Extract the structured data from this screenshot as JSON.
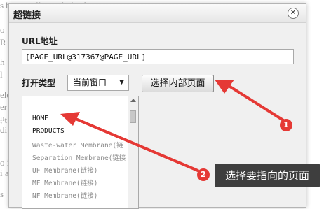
{
  "background": {
    "lines": [
      "s been well popularized",
      "o",
      "R",
      "h",
      "l",
      "ele",
      "er",
      "n",
      ", t",
      "di",
      "o is",
      "i ar",
      "s"
    ]
  },
  "dialog": {
    "title": "超链接",
    "url_label": "URL地址",
    "url_value": "[PAGE_URL@317367@PAGE_URL]",
    "open_type_label": "打开类型",
    "open_type_selected": "当前窗口",
    "internal_page_button": "选择内部页面",
    "page_list": [
      "HOME",
      "PRODUCTS",
      "Waste-water Membrane(链",
      "Separation Membrane(链接",
      "UF Membrane(链接)",
      "MF Membrane(链接)",
      "NF Membrane(链接)"
    ]
  },
  "annotations": {
    "badge_1": "1",
    "badge_2": "2",
    "callout_text": "选择要指向的页面",
    "accent_color": "#e53935"
  }
}
